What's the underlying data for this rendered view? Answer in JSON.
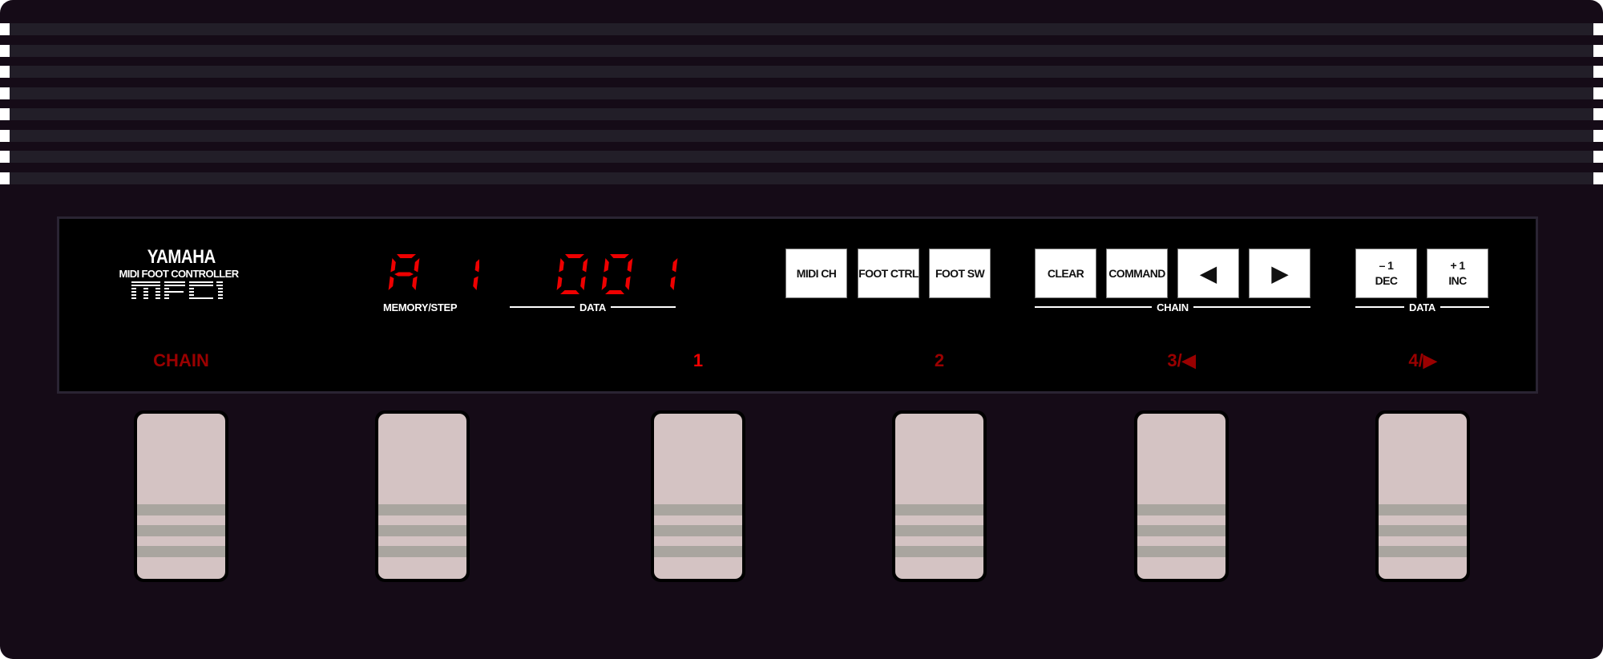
{
  "device": {
    "brand": "YAMAHA",
    "subtitle": "MIDI FOOT CONTROLLER",
    "model": "MFC1",
    "body_color": "#150b17",
    "led_color": "#ee0000"
  },
  "display": {
    "memory_step": {
      "value": "A1",
      "label": "MEMORY/STEP"
    },
    "data": {
      "value": "001",
      "label": "DATA"
    }
  },
  "buttons": {
    "midi_ch": "MIDI CH",
    "foot_ctrl": "FOOT CTRL",
    "foot_sw": "FOOT SW",
    "clear": "CLEAR",
    "command": "COMMAND",
    "prev": "◀",
    "next": "▶",
    "chain_group_label": "CHAIN",
    "dec_top": "– 1",
    "dec_bottom": "DEC",
    "inc_top": "+ 1",
    "inc_bottom": "INC",
    "data_group_label": "DATA"
  },
  "pedals": [
    {
      "label": "CHAIN",
      "active": false
    },
    {
      "label": "",
      "active": false
    },
    {
      "label": "1",
      "active": true
    },
    {
      "label": "2",
      "active": false
    },
    {
      "label": "3/◀",
      "active": false
    },
    {
      "label": "4/▶",
      "active": false
    }
  ]
}
